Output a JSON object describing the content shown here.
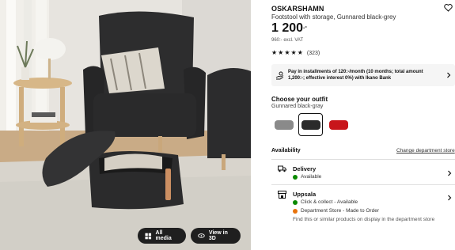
{
  "photo": {
    "all_media_label": "All media",
    "view_3d_label": "View in 3D"
  },
  "product": {
    "brand": "OSKARSHAMN",
    "description": "Footstool with storage, Gunnared black-grey",
    "price": "1 200",
    "price_suffix": ".-",
    "excl_vat": "960:- excl. VAT",
    "rating_stars": 5,
    "review_count": "(323)"
  },
  "installment": {
    "text": "Pay in installments of 120:-/month (10 months; total amount 1,200:-; effective interest 0%) with Ikano Bank"
  },
  "outfit": {
    "title": "Choose your outfit",
    "selected": "Gunnared black-gray",
    "options": [
      {
        "name": "grey",
        "color": "#8a8a8a"
      },
      {
        "name": "black-grey",
        "color": "#2b2b2b"
      },
      {
        "name": "red",
        "color": "#c8151b"
      }
    ]
  },
  "availability": {
    "title": "Availability",
    "change_store": "Change department store",
    "delivery": {
      "title": "Delivery",
      "status": "Available",
      "status_color": "#0a8a00"
    },
    "store": {
      "title": "Uppsala",
      "click_collect": "Click & collect - Available",
      "click_collect_color": "#0a8a00",
      "department_store": "Department Store - Made to Order",
      "department_store_color": "#e8730c",
      "note": "Find this or similar products on display in the department store"
    }
  }
}
